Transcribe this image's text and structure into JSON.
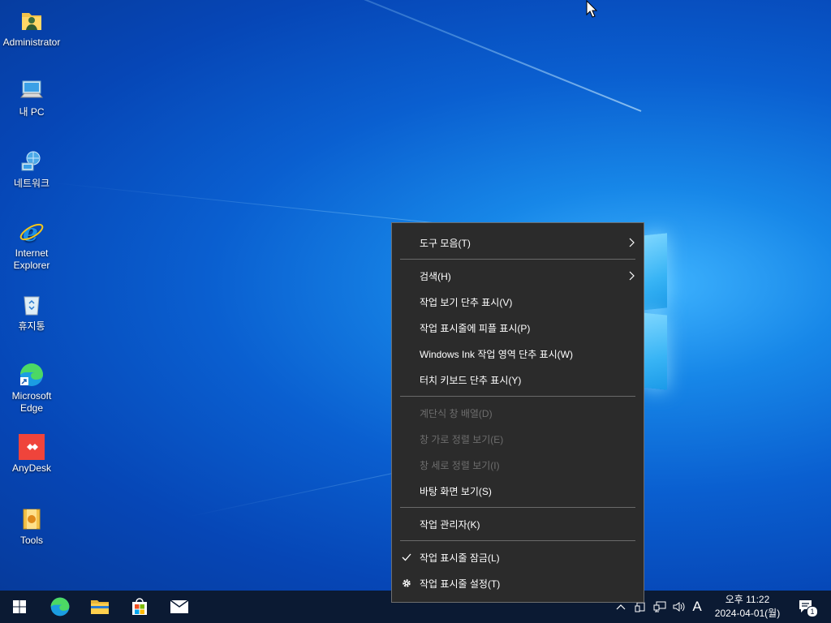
{
  "desktop": {
    "icons": [
      {
        "label": "Administrator",
        "icon": "user-folder-icon"
      },
      {
        "label": "내 PC",
        "icon": "computer-icon"
      },
      {
        "label": "네트워크",
        "icon": "network-icon"
      },
      {
        "label": "Internet\nExplorer",
        "icon": "internet-explorer-icon"
      },
      {
        "label": "휴지통",
        "icon": "recycle-bin-icon"
      },
      {
        "label": "Microsoft\nEdge",
        "icon": "edge-icon"
      },
      {
        "label": "AnyDesk",
        "icon": "anydesk-icon"
      },
      {
        "label": "Tools",
        "icon": "tools-icon"
      }
    ]
  },
  "context_menu": {
    "items": [
      {
        "label": "도구 모음(T)",
        "submenu": true,
        "enabled": true
      },
      {
        "label": "검색(H)",
        "submenu": true,
        "enabled": true
      },
      {
        "label": "작업 보기 단추 표시(V)",
        "enabled": true
      },
      {
        "label": "작업 표시줄에 피플 표시(P)",
        "enabled": true
      },
      {
        "label": "Windows Ink 작업 영역 단추 표시(W)",
        "enabled": true
      },
      {
        "label": "터치 키보드 단추 표시(Y)",
        "enabled": true
      },
      {
        "label": "계단식 창 배열(D)",
        "enabled": false
      },
      {
        "label": "창 가로 정렬 보기(E)",
        "enabled": false
      },
      {
        "label": "창 세로 정렬 보기(I)",
        "enabled": false
      },
      {
        "label": "바탕 화면 보기(S)",
        "enabled": true
      },
      {
        "label": "작업 관리자(K)",
        "enabled": true
      },
      {
        "label": "작업 표시줄 잠금(L)",
        "enabled": true,
        "checked": true
      },
      {
        "label": "작업 표시줄 설정(T)",
        "enabled": true,
        "icon": "gear-icon"
      }
    ]
  },
  "taskbar": {
    "pinned": [
      {
        "name": "start",
        "icon": "windows-start-icon"
      },
      {
        "name": "edge",
        "icon": "edge-icon"
      },
      {
        "name": "file-explorer",
        "icon": "folder-icon"
      },
      {
        "name": "store",
        "icon": "store-icon"
      },
      {
        "name": "mail",
        "icon": "mail-icon"
      }
    ],
    "tray": {
      "input_indicator": "A",
      "time": "오후 11:22",
      "date": "2024-04-01(월)",
      "notification_count": "1"
    }
  },
  "colors": {
    "menu_bg": "#2b2b2b",
    "taskbar_bg": "#0b1a33",
    "disabled_text": "#6d6d6d"
  }
}
